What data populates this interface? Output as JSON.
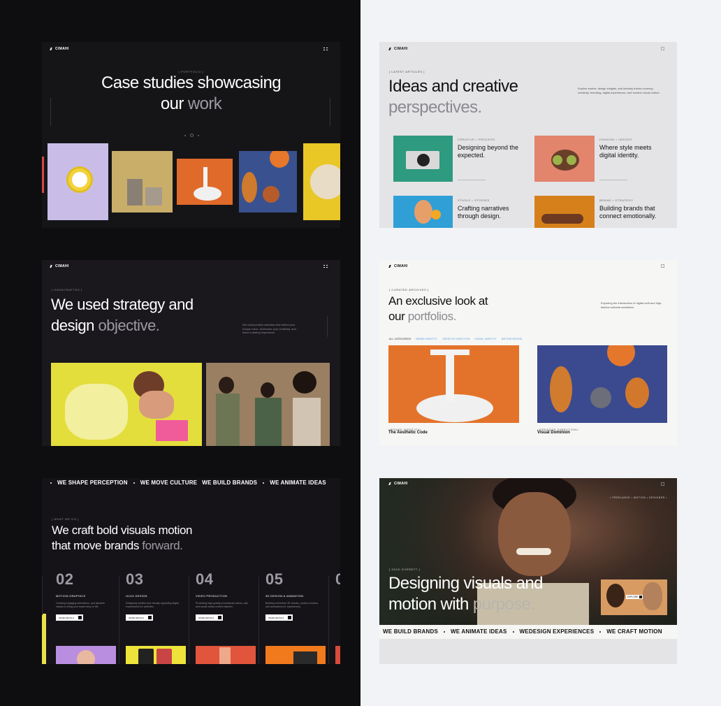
{
  "brand": "CIMAHI",
  "portfolio": {
    "eyebrow": "[ PORTFOLIO ]",
    "title_line1": "Case studies showcasing",
    "title_line2_a": "our",
    "title_line2_b": "work"
  },
  "articles": {
    "eyebrow": "[ LATEST ARTICLES ]",
    "title_line1": "Ideas and creative",
    "title_line2": "perspectives.",
    "intro": "Explore stories, design insights, and industry trends covering creativity, branding, digital experiences, and modern visual culture.",
    "items": [
      {
        "category": "CREATIVE • PROCESS",
        "title": "Designing beyond the expected."
      },
      {
        "category": "FASHION • INSIGHT",
        "title": "Where style meets digital identity."
      },
      {
        "category": "STUDIO • STORIES",
        "title": "Crafting narratives through design."
      },
      {
        "category": "BRAND • STRATEGY",
        "title": "Building brands that connect emotionally."
      }
    ]
  },
  "about": {
    "eyebrow": "[ HANDCRAFTED ]",
    "title_line1": "We used strategy and",
    "title_line2_a": "design",
    "title_line2_b": "objective.",
    "intro": "We craft portfolio websites that reflect your unique voice, showcase your creativity, and leave a lasting impression."
  },
  "archives": {
    "eyebrow": "[ CURATED ARCHIVES ]",
    "title_line1": "An exclusive look at",
    "title_line2_a": "our",
    "title_line2_b": "portfolios.",
    "intro": "Exploring the intersection of digital craft and high-fashion editorial aesthetics.",
    "filters": [
      "ALL CATEGORIES",
      "BRAND IDENTITY",
      "CREATIVE DIRECTION",
      "VISUAL IDENTITY",
      "MOTION DESIGN"
    ],
    "items": [
      {
        "category": "<BRAND IDENTITY>",
        "title": "The Aesthetic Code"
      },
      {
        "category": "<CREATIVE DIRECTION>",
        "title": "Visual Dominion"
      }
    ]
  },
  "services": {
    "ticker": [
      "WE SHAPE PERCEPTION",
      "WE MOVE CULTURE",
      "WE BUILD BRANDS",
      "WE ANIMATE IDEAS"
    ],
    "eyebrow": "[ WHAT WE DO ]",
    "title_line1": "We craft bold visuals motion",
    "title_line2_a": "that move brands",
    "title_line2_b": "forward.",
    "items": [
      {
        "num": "02",
        "name": "MOTION GRAPHICS",
        "desc": "Creating engaging animations, and dynamic visuals to bring your brand story to life.",
        "btn": "MORE DETAILS"
      },
      {
        "num": "03",
        "name": "UI/UX DESIGN",
        "desc": "Designing intuitive and visually appealing digital experiences for websites.",
        "btn": "MORE DETAILS"
      },
      {
        "num": "04",
        "name": "VIDEO PRODUCTION",
        "desc": "Producing high-quality promotional videos, ads, and social media content tailored.",
        "btn": "MORE DETAILS"
      },
      {
        "num": "05",
        "name": "3D DESIGN & ANIMATION",
        "desc": "Building immersive 3D visuals, product renders, and animations for experiences.",
        "btn": "MORE DETAILS"
      }
    ]
  },
  "hero": {
    "tags": "• FREELANCE • MOTION • DESIGNER •",
    "eyebrow": "[ ZACK EVERETT ]",
    "title_line1": "Designing visuals and",
    "title_line2_a": "motion with",
    "title_line2_b": "purpose.",
    "showreel": "EXPLORE",
    "ticker": [
      "WE BUILD BRANDS",
      "WE ANIMATE IDEAS",
      "WE",
      "DESIGN EXPERIENCES",
      "WE CRAFT MOTION"
    ]
  },
  "colors": {
    "left_bg": "#0e0e10",
    "right_bg": "#f2f3f6",
    "muted": "#8d8d92",
    "accent_orange": "#e5732a",
    "accent_yellow": "#e9e04a"
  }
}
